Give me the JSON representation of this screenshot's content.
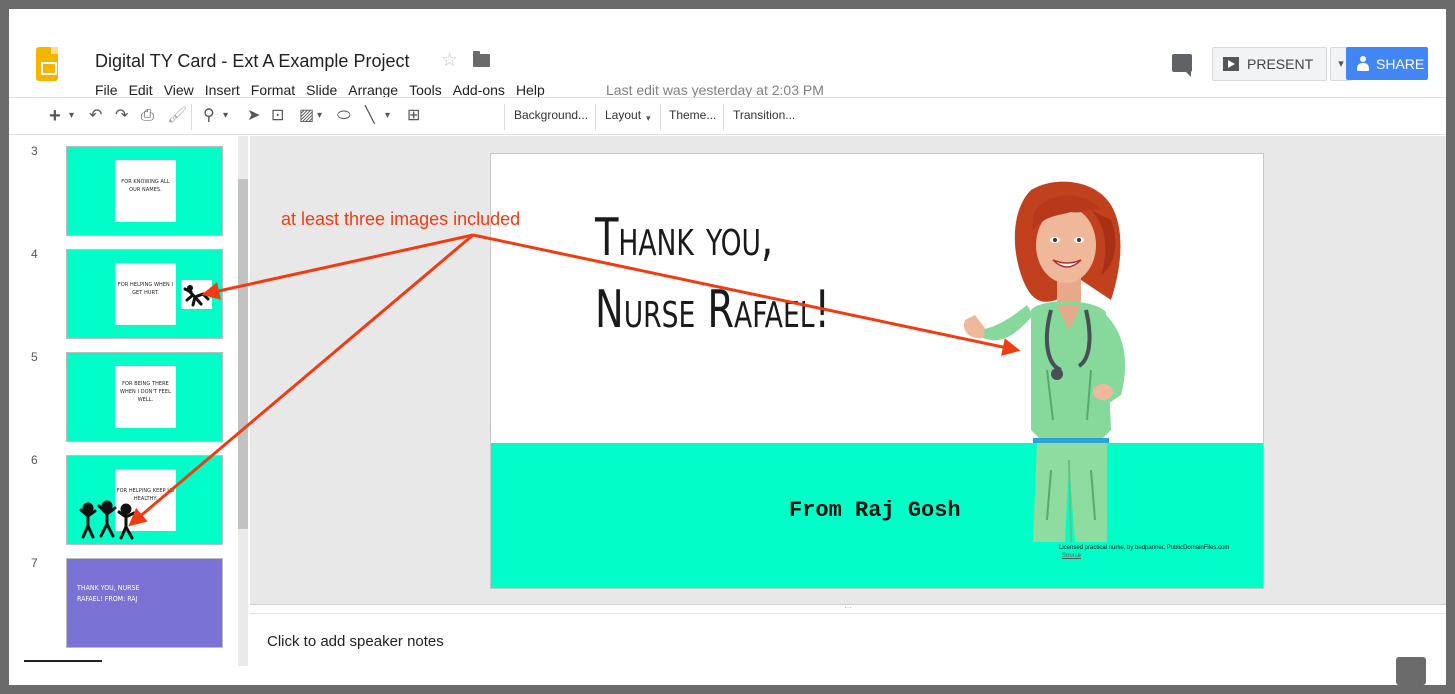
{
  "header": {
    "doc_title": "Digital TY Card - Ext A Example Project",
    "last_edit": "Last edit was yesterday at 2:03 PM",
    "present_label": "PRESENT",
    "share_label": "SHARE"
  },
  "menu": [
    "File",
    "Edit",
    "View",
    "Insert",
    "Format",
    "Slide",
    "Arrange",
    "Tools",
    "Add-ons",
    "Help"
  ],
  "toolbar": {
    "background_label": "Background...",
    "layout_label": "Layout",
    "theme_label": "Theme...",
    "transition_label": "Transition..."
  },
  "filmstrip": {
    "slides": [
      {
        "number": "3",
        "text": "For knowing all our names."
      },
      {
        "number": "4",
        "text": "For helping when I get hurt."
      },
      {
        "number": "5",
        "text": "For being there when I don't feel well."
      },
      {
        "number": "6",
        "text": "For helping keep us healthy."
      },
      {
        "number": "7",
        "text": "Thank you, Nurse Rafael! From: Raj"
      }
    ]
  },
  "slide": {
    "title_line1": "Thank you,",
    "title_line2": "Nurse Rafael!",
    "from": "From Raj Gosh",
    "credit": "Licensed practical nurse, by bedpanner, PublicDomainFiles.com",
    "source": "Source"
  },
  "notes": {
    "placeholder": "Click to add speaker notes"
  },
  "annotation": {
    "label": "at least three images included"
  },
  "colors": {
    "slide_band": "#00ffc8",
    "selected_thumb": "#7b72d6",
    "share_button": "#4285f4",
    "annotation": "#f03c12"
  }
}
